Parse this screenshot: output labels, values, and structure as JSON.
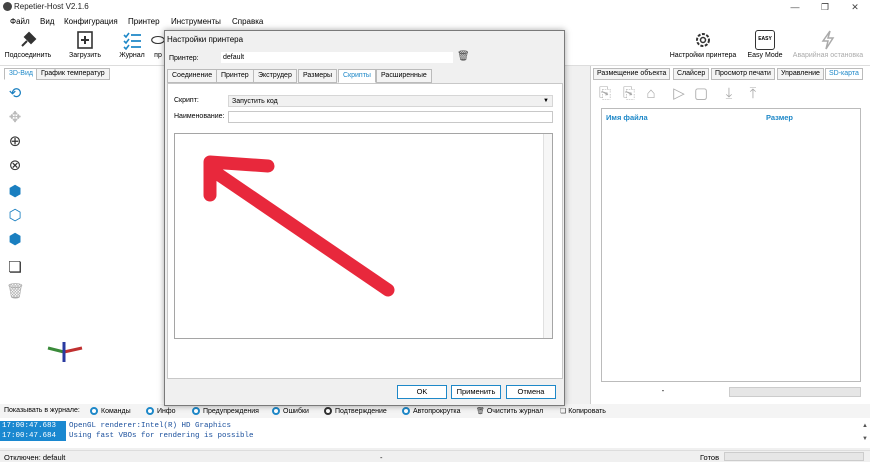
{
  "window": {
    "title": "Repetier-Host V2.1.6",
    "min": "—",
    "max": "❐",
    "close": "✕"
  },
  "menu": [
    "Файл",
    "Вид",
    "Конфигурация",
    "Принтер",
    "Инструменты",
    "Справка"
  ],
  "toolbar": {
    "connect": "Подсоединить",
    "load": "Загрузить",
    "log": "Журнал",
    "print_partial": "пр",
    "printer_settings": "Настройки принтера",
    "easy_mode": "Easy Mode",
    "easy_badge": "EASY",
    "emergency_stop": "Аварийная остановка"
  },
  "left_tabs": [
    "3D-Вид",
    "График температур"
  ],
  "right_tabs": [
    "Размещение объекта",
    "Слайсер",
    "Просмотр печати",
    "Управление",
    "SD-карта"
  ],
  "sd_table": {
    "col_name": "Имя файла",
    "col_size": "Размер",
    "bottom_value": "-"
  },
  "dialog": {
    "title": "Настройки принтера",
    "printer_label": "Принтер:",
    "printer_value": "default",
    "tabs": [
      "Соединение",
      "Принтер",
      "Экструдер",
      "Размеры",
      "Скрипты",
      "Расширенные"
    ],
    "active_tab": "Скрипты",
    "script_label": "Скрипт:",
    "script_value": "Запустить код",
    "name_label": "Наименование:",
    "name_value": "",
    "ok": "OK",
    "apply": "Применить",
    "cancel": "Отмена"
  },
  "log": {
    "show_label": "Показывать в журнале:",
    "options": [
      "Команды",
      "Инфо",
      "Предупреждения",
      "Ошибки",
      "Подтверждение",
      "Автопрокрутка",
      "Очистить журнал",
      "Копировать"
    ],
    "lines": [
      {
        "time": "17:00:47.683",
        "msg": "OpenGL renderer:Intel(R) HD Graphics"
      },
      {
        "time": "17:00:47.684",
        "msg": "Using fast VBOs for rendering is possible"
      }
    ]
  },
  "status": {
    "left": "Отключен: default",
    "mid": "-",
    "ready": "Готов"
  },
  "colors": {
    "accent": "#1e88c8",
    "annotation": "#e8283c"
  }
}
